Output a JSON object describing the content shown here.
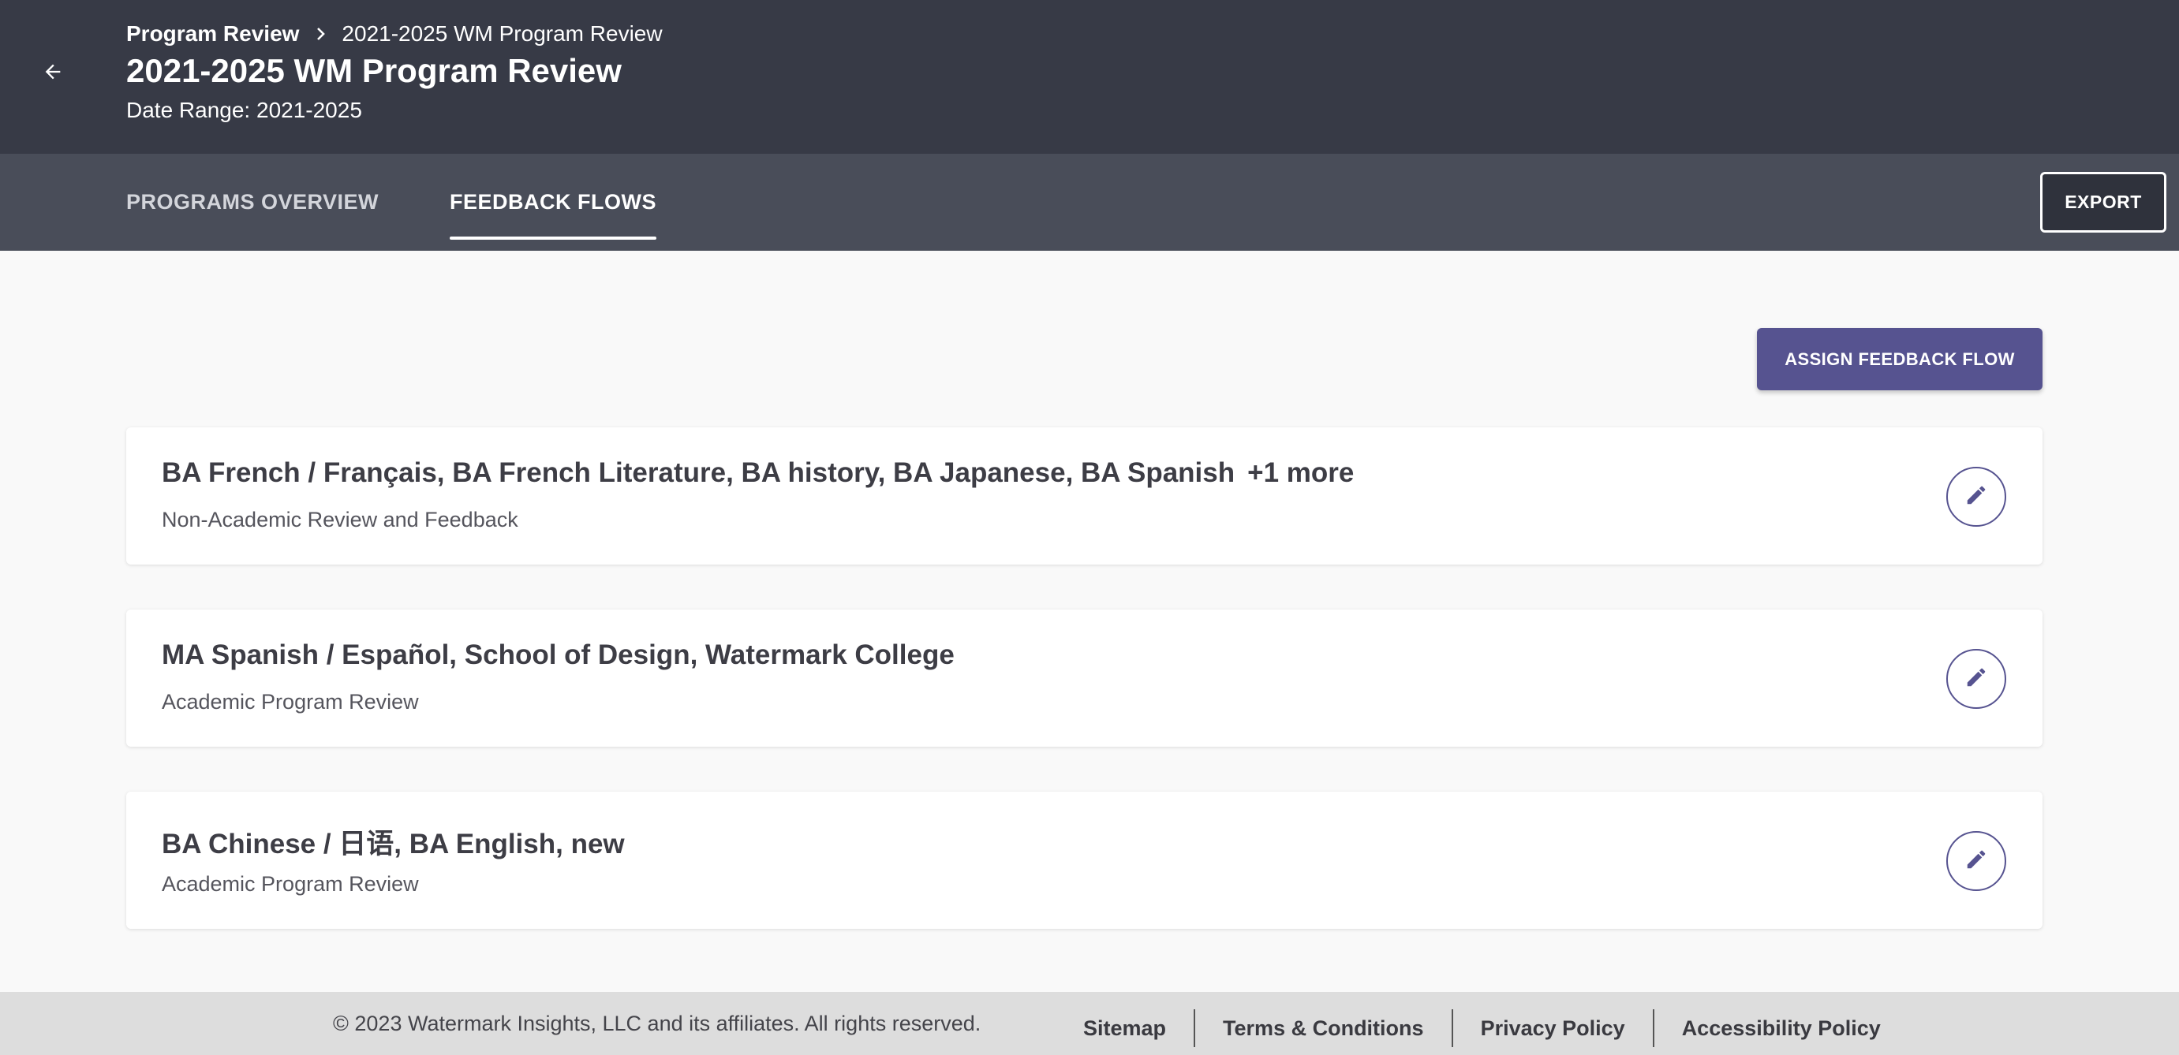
{
  "header": {
    "breadcrumb": {
      "parent": "Program Review",
      "current": "2021-2025 WM Program Review"
    },
    "title": "2021-2025 WM Program Review",
    "date_range": "Date Range: 2021-2025"
  },
  "tabs": [
    {
      "label": "PROGRAMS OVERVIEW",
      "active": false
    },
    {
      "label": "FEEDBACK FLOWS",
      "active": true
    }
  ],
  "toolbar": {
    "export_label": "EXPORT",
    "assign_label": "ASSIGN FEEDBACK FLOW"
  },
  "flows": [
    {
      "programs": "BA French / Français, BA French Literature, BA history, BA Japanese, BA Spanish",
      "more": "+1 more",
      "type": "Non-Academic Review and Feedback"
    },
    {
      "programs": "MA Spanish / Español, School of Design, Watermark College",
      "more": "",
      "type": "Academic Program Review"
    },
    {
      "programs": "BA Chinese / 日语, BA English, new",
      "more": "",
      "type": "Academic Program Review"
    }
  ],
  "footer": {
    "copyright": "© 2023 Watermark Insights, LLC and its affiliates. All rights reserved.",
    "links": [
      "Sitemap",
      "Terms & Conditions",
      "Privacy Policy",
      "Accessibility Policy"
    ]
  },
  "icons": {
    "back": "arrow-left-icon",
    "breadcrumb_separator": "chevron-right-icon",
    "edit": "pencil-icon"
  },
  "colors": {
    "header_bg": "#373a46",
    "tabbar_bg": "#494d59",
    "accent": "#565390",
    "footer_bg": "#dddddd"
  }
}
